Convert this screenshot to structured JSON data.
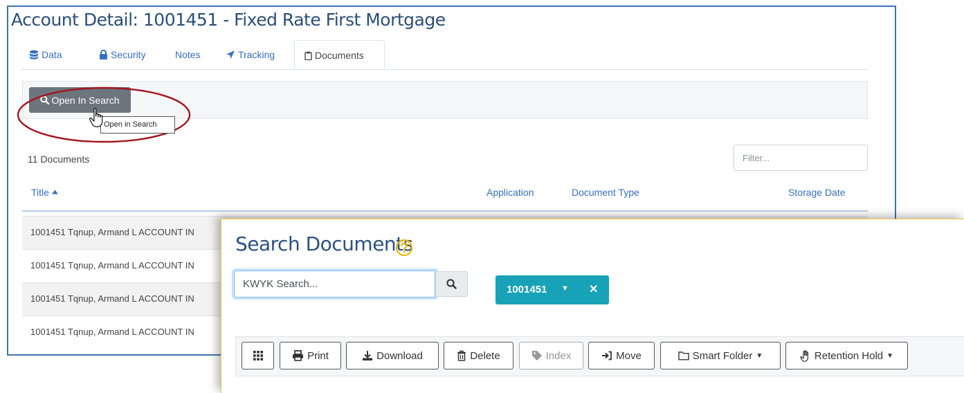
{
  "account_detail": {
    "title": "Account Detail: 1001451 - Fixed Rate First Mortgage",
    "tabs": [
      {
        "label": "Data",
        "icon": "database-icon"
      },
      {
        "label": "Security",
        "icon": "lock-icon"
      },
      {
        "label": "Notes",
        "icon": ""
      },
      {
        "label": "Tracking",
        "icon": "location-arrow-icon"
      },
      {
        "label": "Documents",
        "icon": "clipboard-icon",
        "active": true
      }
    ],
    "open_in_search_label": "Open In Search",
    "tooltip": "Open in Search",
    "doc_count": "11 Documents",
    "filter_placeholder": "Filter...",
    "columns": {
      "title": "Title",
      "application": "Application",
      "document_type": "Document Type",
      "storage_date": "Storage Date"
    },
    "rows": [
      "1001451 Tqnup, Armand L ACCOUNT IN",
      "1001451 Tqnup, Armand L ACCOUNT IN",
      "1001451 Tqnup, Armand L ACCOUNT IN",
      "1001451 Tqnup, Armand L ACCOUNT IN"
    ]
  },
  "search_documents": {
    "title": "Search Documents",
    "search_placeholder": "KWYK Search...",
    "account_chip": "1001451",
    "actions": {
      "print": "Print",
      "download": "Download",
      "delete": "Delete",
      "index": "Index",
      "move": "Move",
      "smart_folder": "Smart Folder",
      "retention_hold": "Retention Hold"
    }
  },
  "colors": {
    "link": "#3370c4",
    "title": "#2a4e7d",
    "panel_border": "#3d73b5",
    "highlight_ellipse": "#a3141e",
    "chip": "#17a2b8",
    "help_icon": "#f0b400"
  }
}
